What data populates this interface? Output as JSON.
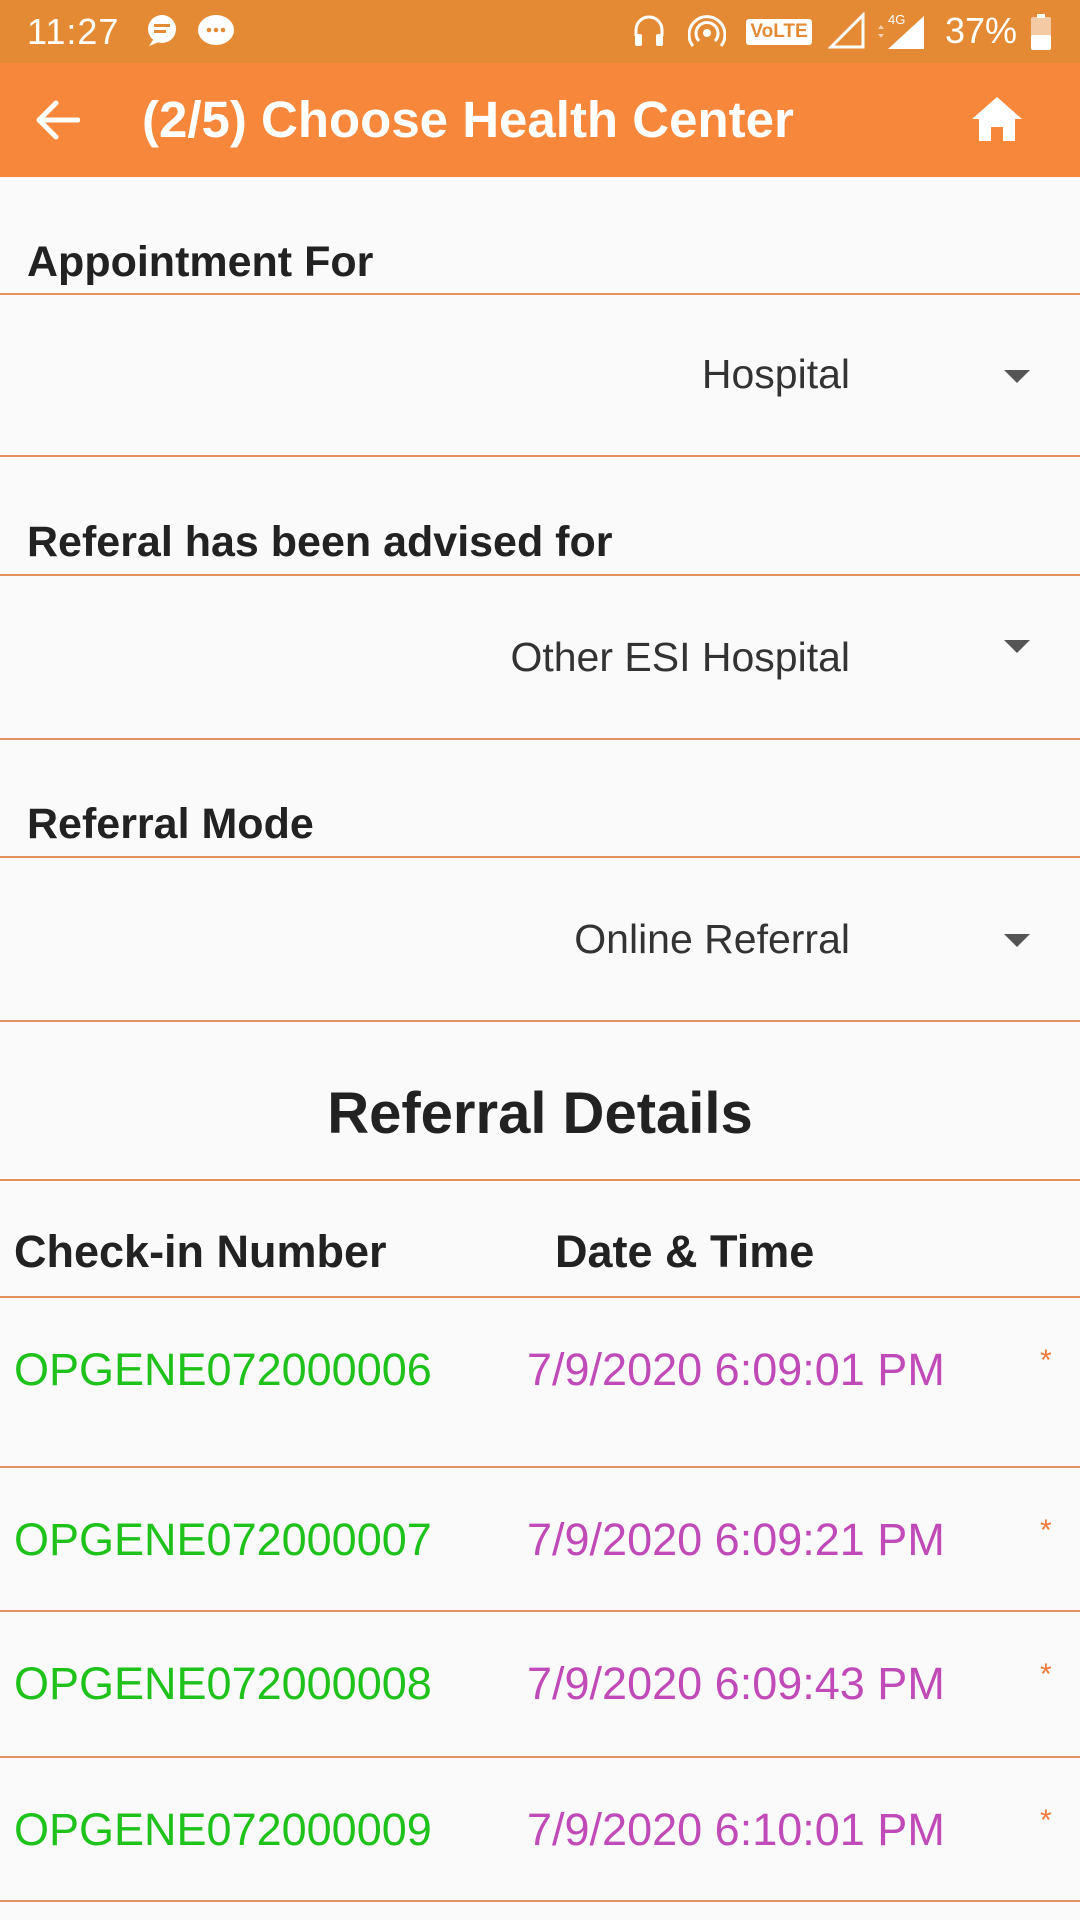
{
  "status_bar": {
    "time": "11:27",
    "battery": "37%",
    "icons": [
      "chat-bubble-icon",
      "message-icon",
      "headset-icon",
      "hotspot-icon",
      "volte-icon",
      "signal-icon",
      "4g-signal-icon",
      "battery-icon"
    ],
    "volte_label": "VoLTE",
    "net_label": "4G"
  },
  "app_bar": {
    "title": "(2/5) Choose Health Center",
    "back_icon": "arrow-left-icon",
    "home_icon": "home-icon",
    "color": "#f7873a"
  },
  "form": {
    "appointment_for": {
      "label": "Appointment For",
      "value": "Hospital"
    },
    "referral_advised": {
      "label": "Referal has been advised for",
      "value": "Other ESI Hospital"
    },
    "referral_mode": {
      "label": "Referral Mode",
      "value": "Online Referral"
    }
  },
  "referral_details": {
    "title": "Referral Details",
    "headers": {
      "checkin": "Check-in Number",
      "datetime": "Date & Time"
    },
    "rows": [
      {
        "checkin": "OPGENE072000006",
        "datetime": "7/9/2020 6:09:01 PM",
        "mark": "*"
      },
      {
        "checkin": "OPGENE072000007",
        "datetime": "7/9/2020 6:09:21 PM",
        "mark": "*"
      },
      {
        "checkin": "OPGENE072000008",
        "datetime": "7/9/2020 6:09:43 PM",
        "mark": "*"
      },
      {
        "checkin": "OPGENE072000009",
        "datetime": "7/9/2020 6:10:01 PM",
        "mark": "*"
      }
    ],
    "checkin_color": "#1fc21b",
    "datetime_color": "#c04ab8"
  }
}
